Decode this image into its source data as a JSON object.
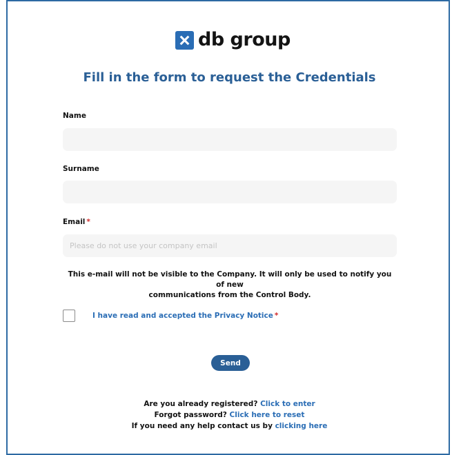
{
  "brand": {
    "name": "db group"
  },
  "form": {
    "title": "Fill in the form to request the Credentials",
    "name_label": "Name",
    "name_value": "",
    "surname_label": "Surname",
    "surname_value": "",
    "email_label": "Email",
    "email_value": "",
    "email_placeholder": "Please do not use your company email",
    "required_mark": "*",
    "email_notice_line1": "This e-mail will not be visible to the Company. It will only be used to notify you of new",
    "email_notice_line2": "communications from the Control Body.",
    "privacy_label": "I have read and accepted the Privacy Notice",
    "privacy_checked": false,
    "send_label": "Send"
  },
  "footer": {
    "registered_text": "Are you already registered?",
    "registered_link": "Click to enter",
    "forgot_text": "Forgot password?",
    "forgot_link": "Click here to reset",
    "help_text": "If you need any help contact us by",
    "help_link": "clicking here"
  },
  "colors": {
    "primary": "#2a5f96",
    "link": "#2a6db5",
    "required": "#d12b2b",
    "frame_border": "#2d6aa3",
    "input_bg": "#f5f5f5"
  },
  "icons": {
    "logo": "db-group-logo-icon"
  }
}
